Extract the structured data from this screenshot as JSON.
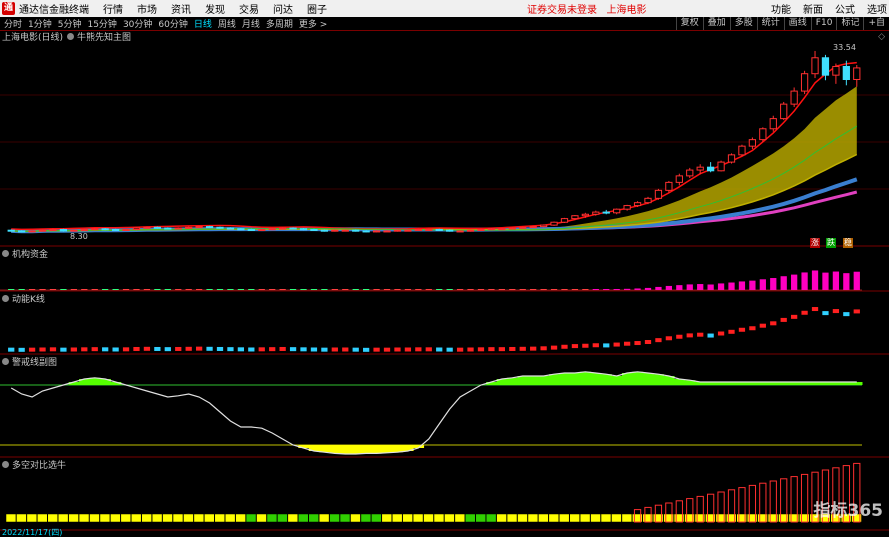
{
  "menubar": {
    "app_title": "通达信金融终端",
    "items": [
      "行情",
      "市场",
      "资讯",
      "发现",
      "交易",
      "问达",
      "圈子"
    ],
    "notice": "证券交易未登录",
    "stock": "上海电影",
    "right_items": [
      "功能",
      "新面",
      "公式",
      "选项"
    ]
  },
  "toolbar": {
    "periods": [
      "分时",
      "1分钟",
      "5分钟",
      "15分钟",
      "30分钟",
      "60分钟",
      "日线",
      "周线",
      "月线",
      "多周期",
      "更多 >"
    ],
    "active_period": "日线",
    "right_buttons": [
      "复权",
      "叠加",
      "多股",
      "统计",
      "画线",
      "F10",
      "标记",
      "+自"
    ]
  },
  "main_panel": {
    "title": "上海电影(日线)",
    "indicator": "牛熊先知主图",
    "high_label": "33.54",
    "low_label": "8.30",
    "tags": [
      "涨",
      "跌",
      "稳"
    ]
  },
  "panels": [
    {
      "title": "机构资金"
    },
    {
      "title": "动能K线"
    },
    {
      "title": "警戒线副图"
    },
    {
      "title": "多空对比选牛"
    }
  ],
  "date_label": "2022/11/17(四)",
  "watermark": "指标365",
  "colors": {
    "up": "#ff3030",
    "down": "#40e0ff",
    "accent": "#00e0ff",
    "warning_band": "#ffff00",
    "safe_band": "#55ff00"
  },
  "chart_data": {
    "type": "candlestick",
    "title": "上海电影(日线)",
    "y_high": 33.54,
    "y_low": 8.3,
    "ohlc": [
      [
        8.8,
        8.9,
        8.6,
        8.7
      ],
      [
        8.7,
        8.8,
        8.5,
        8.6
      ],
      [
        8.6,
        8.8,
        8.5,
        8.7
      ],
      [
        8.7,
        8.9,
        8.6,
        8.8
      ],
      [
        8.8,
        9.0,
        8.7,
        8.9
      ],
      [
        8.9,
        9.0,
        8.6,
        8.7
      ],
      [
        8.7,
        8.9,
        8.6,
        8.8
      ],
      [
        8.8,
        9.0,
        8.7,
        8.9
      ],
      [
        8.9,
        9.1,
        8.8,
        9.0
      ],
      [
        9.0,
        9.1,
        8.8,
        8.9
      ],
      [
        8.9,
        9.0,
        8.7,
        8.8
      ],
      [
        8.8,
        9.0,
        8.7,
        8.9
      ],
      [
        8.9,
        9.2,
        8.8,
        9.1
      ],
      [
        9.1,
        9.3,
        9.0,
        9.2
      ],
      [
        9.2,
        9.3,
        9.0,
        9.1
      ],
      [
        9.1,
        9.2,
        8.9,
        9.0
      ],
      [
        9.0,
        9.2,
        8.9,
        9.1
      ],
      [
        9.1,
        9.3,
        9.0,
        9.2
      ],
      [
        9.2,
        9.4,
        9.1,
        9.3
      ],
      [
        9.3,
        9.4,
        9.1,
        9.2
      ],
      [
        9.2,
        9.3,
        9.0,
        9.1
      ],
      [
        9.1,
        9.2,
        8.9,
        9.0
      ],
      [
        9.0,
        9.1,
        8.8,
        8.9
      ],
      [
        8.9,
        9.0,
        8.7,
        8.8
      ],
      [
        8.8,
        9.0,
        8.7,
        8.9
      ],
      [
        8.9,
        9.1,
        8.8,
        9.0
      ],
      [
        9.0,
        9.2,
        8.9,
        9.1
      ],
      [
        9.1,
        9.2,
        8.9,
        9.0
      ],
      [
        9.0,
        9.1,
        8.8,
        8.9
      ],
      [
        8.9,
        9.0,
        8.7,
        8.8
      ],
      [
        8.8,
        8.9,
        8.6,
        8.7
      ],
      [
        8.7,
        8.9,
        8.6,
        8.8
      ],
      [
        8.8,
        8.9,
        8.7,
        8.8
      ],
      [
        8.8,
        8.9,
        8.6,
        8.7
      ],
      [
        8.7,
        8.8,
        8.5,
        8.6
      ],
      [
        8.6,
        8.8,
        8.5,
        8.7
      ],
      [
        8.7,
        8.8,
        8.6,
        8.7
      ],
      [
        8.7,
        8.9,
        8.6,
        8.8
      ],
      [
        8.8,
        8.9,
        8.7,
        8.8
      ],
      [
        8.8,
        9.0,
        8.7,
        8.9
      ],
      [
        8.9,
        9.0,
        8.8,
        8.9
      ],
      [
        8.9,
        9.0,
        8.7,
        8.8
      ],
      [
        8.8,
        8.9,
        8.6,
        8.7
      ],
      [
        8.7,
        8.8,
        8.6,
        8.7
      ],
      [
        8.7,
        8.9,
        8.6,
        8.8
      ],
      [
        8.8,
        9.0,
        8.7,
        8.9
      ],
      [
        8.9,
        9.1,
        8.8,
        9.0
      ],
      [
        9.0,
        9.1,
        8.9,
        9.0
      ],
      [
        9.0,
        9.2,
        8.9,
        9.1
      ],
      [
        9.1,
        9.3,
        9.0,
        9.2
      ],
      [
        9.2,
        9.4,
        9.1,
        9.3
      ],
      [
        9.3,
        9.6,
        9.2,
        9.5
      ],
      [
        9.5,
        10.0,
        9.4,
        9.9
      ],
      [
        9.9,
        10.5,
        9.8,
        10.4
      ],
      [
        10.4,
        10.9,
        10.2,
        10.8
      ],
      [
        10.8,
        11.2,
        10.5,
        11.0
      ],
      [
        11.0,
        11.5,
        10.8,
        11.3
      ],
      [
        11.3,
        11.6,
        11.0,
        11.2
      ],
      [
        11.2,
        11.8,
        11.0,
        11.7
      ],
      [
        11.7,
        12.3,
        11.5,
        12.2
      ],
      [
        12.2,
        12.8,
        12.0,
        12.6
      ],
      [
        12.6,
        13.4,
        12.4,
        13.2
      ],
      [
        13.2,
        14.5,
        13.0,
        14.3
      ],
      [
        14.3,
        15.6,
        14.0,
        15.4
      ],
      [
        15.4,
        16.6,
        15.0,
        16.3
      ],
      [
        16.3,
        17.4,
        16.0,
        17.1
      ],
      [
        17.1,
        17.9,
        16.5,
        17.5
      ],
      [
        17.5,
        18.2,
        16.8,
        17.0
      ],
      [
        17.0,
        18.4,
        16.9,
        18.2
      ],
      [
        18.2,
        19.4,
        18.0,
        19.2
      ],
      [
        19.2,
        20.6,
        19.0,
        20.4
      ],
      [
        20.4,
        21.6,
        20.0,
        21.3
      ],
      [
        21.3,
        23.0,
        21.0,
        22.8
      ],
      [
        22.8,
        24.6,
        22.4,
        24.2
      ],
      [
        24.2,
        26.5,
        24.0,
        26.2
      ],
      [
        26.2,
        28.5,
        25.8,
        28.0
      ],
      [
        28.0,
        30.8,
        27.6,
        30.4
      ],
      [
        30.4,
        33.54,
        29.8,
        32.6
      ],
      [
        32.6,
        33.0,
        29.5,
        30.2
      ],
      [
        30.2,
        31.8,
        29.0,
        31.4
      ],
      [
        31.4,
        32.2,
        28.8,
        29.6
      ],
      [
        29.6,
        31.6,
        28.6,
        31.2
      ]
    ],
    "ylim": [
      8.0,
      34.5
    ]
  }
}
